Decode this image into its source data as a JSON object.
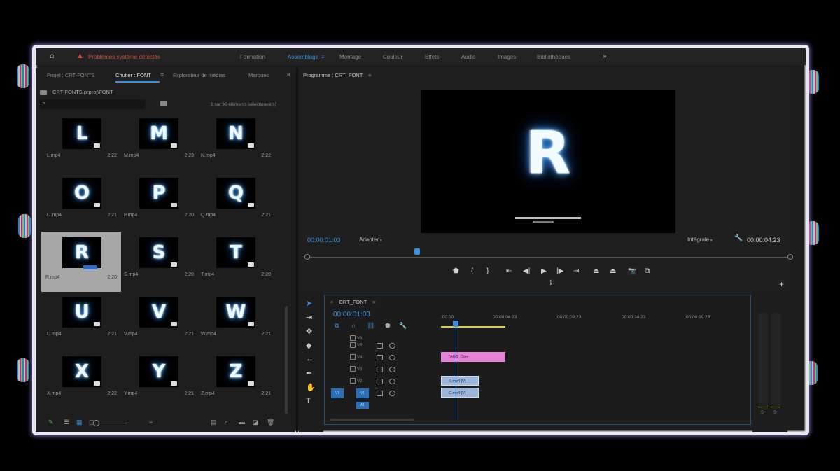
{
  "workspace": {
    "warning": "Problèmes système détectés",
    "tabs": [
      {
        "label": "Formation",
        "active": false
      },
      {
        "label": "Assemblage",
        "active": true
      },
      {
        "label": "Montage",
        "active": false
      },
      {
        "label": "Couleur",
        "active": false
      },
      {
        "label": "Effets",
        "active": false
      },
      {
        "label": "Audio",
        "active": false
      },
      {
        "label": "Images",
        "active": false
      },
      {
        "label": "Bibliothèques",
        "active": false
      }
    ],
    "more_icon": "double-chevron-right-icon"
  },
  "project_panel": {
    "tabs": [
      "Projet : CRT-FONTS",
      "Chutier : FONT",
      "Explorateur de médias",
      "Marques"
    ],
    "active_tab": "Chutier : FONT",
    "path": "CRT-FONTS.prproj\\FONT",
    "search_placeholder": "",
    "selection_count": "1 sur 36 éléments sélectionné(s)",
    "items": [
      {
        "letter": "L",
        "name": "L.mp4",
        "duration": "2:22",
        "selected": false
      },
      {
        "letter": "M",
        "name": "M.mp4",
        "duration": "2:23",
        "selected": false
      },
      {
        "letter": "N",
        "name": "N.mp4",
        "duration": "2:22",
        "selected": false
      },
      {
        "letter": "O",
        "name": "O.mp4",
        "duration": "2:21",
        "selected": false
      },
      {
        "letter": "P",
        "name": "P.mp4",
        "duration": "2:20",
        "selected": false
      },
      {
        "letter": "Q",
        "name": "Q.mp4",
        "duration": "2:21",
        "selected": false
      },
      {
        "letter": "R",
        "name": "R.mp4",
        "duration": "2:20",
        "selected": true
      },
      {
        "letter": "S",
        "name": "S.mp4",
        "duration": "2:20",
        "selected": false
      },
      {
        "letter": "T",
        "name": "T.mp4",
        "duration": "2:20",
        "selected": false
      },
      {
        "letter": "U",
        "name": "U.mp4",
        "duration": "2:21",
        "selected": false
      },
      {
        "letter": "V",
        "name": "V.mp4",
        "duration": "2:21",
        "selected": false
      },
      {
        "letter": "W",
        "name": "W.mp4",
        "duration": "2:21",
        "selected": false
      },
      {
        "letter": "X",
        "name": "X.mp4",
        "duration": "2:22",
        "selected": false
      },
      {
        "letter": "Y",
        "name": "Y.mp4",
        "duration": "2:21",
        "selected": false
      },
      {
        "letter": "Z",
        "name": "Z.mp4",
        "duration": "2:21",
        "selected": false
      }
    ]
  },
  "program_monitor": {
    "title": "Programme : CRT_FONT",
    "frame_letter": "R",
    "timecode": "00:00:01:03",
    "fit": "Adapter",
    "quality": "Intégrale",
    "duration": "00:00:04:23",
    "transport_icons": [
      "marker-icon",
      "in-point-icon",
      "out-point-icon",
      "go-to-in-icon",
      "step-back-icon",
      "play-icon",
      "step-forward-icon",
      "go-to-out-icon",
      "lift-icon",
      "extract-icon",
      "export-frame-icon",
      "compare-icon"
    ]
  },
  "timeline": {
    "title": "CRT_FONT",
    "timecode": "00:00:01:03",
    "ruler": [
      ":00:00",
      "00:00:04:23",
      "00:00:09:23",
      "00:00:14:23",
      "00:00:19:23"
    ],
    "tracks": [
      {
        "label": "V6",
        "clip": ""
      },
      {
        "label": "V5",
        "clip": ""
      },
      {
        "label": "V4",
        "clip": "TAGS_Core"
      },
      {
        "label": "V3",
        "clip": ""
      },
      {
        "label": "V2",
        "clip": "R.mp4 [V]"
      },
      {
        "label": "V1",
        "clip": "C.mp4 [V]"
      },
      {
        "label": "A1",
        "clip": ""
      }
    ],
    "source_patch": "V1"
  },
  "audio_meter": {
    "labels": [
      "S",
      "S"
    ]
  },
  "colors": {
    "accent": "#3a8fe0",
    "warning": "#d05040",
    "pink_clip": "#e584d7",
    "video_clip": "#9bb6d8"
  }
}
